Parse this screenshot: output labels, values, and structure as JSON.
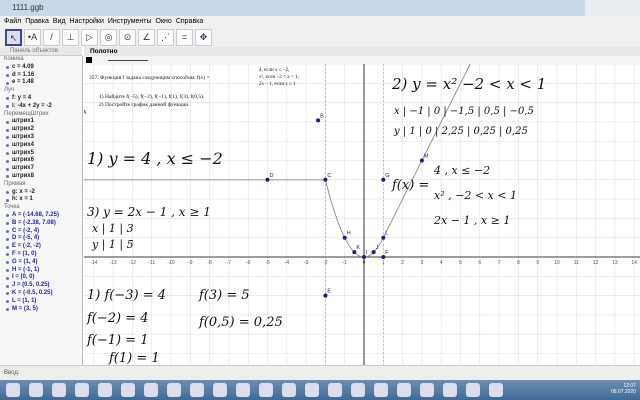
{
  "window": {
    "title": "1111.ggb"
  },
  "menu": [
    "Файл",
    "Правка",
    "Вид",
    "Настройки",
    "Инструменты",
    "Окно",
    "Справка"
  ],
  "toolbar": {
    "tools": [
      "move",
      "point",
      "line",
      "perpendicular",
      "polygon",
      "circle",
      "conic",
      "angle",
      "reflect",
      "slider",
      "move-view"
    ]
  },
  "algebra": {
    "title": "Панель объектов",
    "groups": [
      {
        "name": "Коника",
        "items": [
          "c = 4.09",
          "d = 1.16",
          "e = 1.48"
        ]
      },
      {
        "name": "Луч",
        "items": [
          "f: y = 4",
          "i: -4x + 2y = -2"
        ]
      },
      {
        "name": "ПеремещШтрих",
        "items": [
          "штрих1",
          "штрих2",
          "штрих3",
          "штрих4",
          "штрих5",
          "штрих6",
          "штрих7",
          "штрих8"
        ]
      },
      {
        "name": "Прямая",
        "items": [
          "g: x = -2",
          "h: x = 1"
        ]
      },
      {
        "name": "Точка",
        "items": [
          "A = (-14.68, 7.25)",
          "B = (-2.38, 7.08)",
          "C = (-2, 4)",
          "D = (-5, 4)",
          "E = (-2, -2)",
          "F = (1, 0)",
          "G = (1, 4)",
          "H = (-1, 1)",
          "I = (0, 0)",
          "J = (0.5, 0.25)",
          "K = (-0.5, 0.25)",
          "L = (1, 1)",
          "M = (3, 5)"
        ]
      }
    ]
  },
  "canvas": {
    "title": "Полотно"
  },
  "problem": {
    "line1": "357. Функция f задана следующим способом: f(x) =",
    "cases": [
      "4, если x ≤ −2,",
      "x², если −2 < x < 1,",
      "2x − 1, если x ≥ 1"
    ],
    "q1": "1) Найдите f(−5), f(−2), f(−1), f(1), f(3), f(0,5).",
    "q2": "2) Постройте график данной функции."
  },
  "graph": {
    "xrange": [
      -14,
      14
    ],
    "yrange": [
      -5,
      10
    ],
    "grid": true,
    "axis_labels": [
      "-14",
      "-13",
      "-12",
      "-11",
      "-10",
      "-9",
      "-8",
      "-7",
      "-6",
      "-5",
      "-4",
      "-3",
      "-2",
      "-1",
      "0",
      "1",
      "2",
      "3",
      "4",
      "5",
      "6",
      "7",
      "8",
      "9",
      "10",
      "11",
      "12",
      "13",
      "14"
    ],
    "points": [
      {
        "n": "A",
        "x": -14.68,
        "y": 7.25
      },
      {
        "n": "B",
        "x": -2.38,
        "y": 7.08
      },
      {
        "n": "C",
        "x": -2,
        "y": 4
      },
      {
        "n": "D",
        "x": -5,
        "y": 4
      },
      {
        "n": "E",
        "x": -2,
        "y": -2
      },
      {
        "n": "F",
        "x": 1,
        "y": 0
      },
      {
        "n": "G",
        "x": 1,
        "y": 4
      },
      {
        "n": "H",
        "x": -1,
        "y": 1
      },
      {
        "n": "I",
        "x": 0,
        "y": 0
      },
      {
        "n": "J",
        "x": 0.5,
        "y": 0.25
      },
      {
        "n": "K",
        "x": -0.5,
        "y": 0.25
      },
      {
        "n": "L",
        "x": 1,
        "y": 1
      },
      {
        "n": "M",
        "x": 3,
        "y": 5
      }
    ],
    "colors": {
      "point": "#1a1a8a",
      "curve": "#888888",
      "axis": "#000000"
    }
  },
  "handwriting": {
    "n1": "1) y = 4 , x ≤ −2",
    "n2": "2) y = x²   −2 < x < 1",
    "table_x": "x | −1 | 0 | −1,5 | 0,5 | −0,5",
    "table_y": "y | 1 | 0 | 2,25 | 0,25 | 0,25",
    "n3": "3) y = 2x − 1 , x ≥ 1",
    "t3x": "x | 1 | 3",
    "t3y": "y | 1 | 5",
    "sys": [
      "4 , x ≤ −2",
      "x² , −2 < x < 1",
      "2x − 1 , x ≥ 1"
    ],
    "fx": "f(x) =",
    "v1": "1) f(−3) = 4",
    "v2": "f(3) = 5",
    "v3": "f(−2) = 4",
    "v4": "f(−1) = 1",
    "v5": "f(0,5) = 0,25",
    "v6": "f(1) = 1"
  },
  "inputbar": {
    "label": "Ввод:"
  },
  "clock": {
    "time": "12:07",
    "date": "08.07.2020"
  }
}
